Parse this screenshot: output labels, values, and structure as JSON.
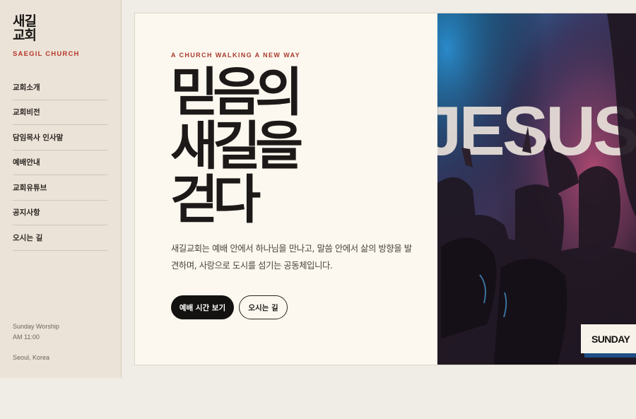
{
  "brand": {
    "name_ko": "새길 교회",
    "name_en": "SAEGIL CHURCH",
    "accent_color": "#b8362b"
  },
  "nav": {
    "items": [
      {
        "label": "교회소개"
      },
      {
        "label": "교회비전"
      },
      {
        "label": "담임목사 인사말"
      },
      {
        "label": "예배안내"
      },
      {
        "label": "교회유튜브"
      },
      {
        "label": "공지사항"
      },
      {
        "label": "오시는 길"
      }
    ]
  },
  "sidebar_info": {
    "worship_name": "Sunday Worship",
    "worship_time": "AM 11:00",
    "location": "Seoul, Korea"
  },
  "hero": {
    "eyebrow": "A CHURCH WALKING A NEW WAY",
    "headline_line1": "믿음의",
    "headline_line2": "새길을",
    "headline_line3": "걷다",
    "description": "새길교회는 예배 안에서 하나님을 만나고, 말씀 안에서 삶의 방향을 발견하며, 사랑으로 도시를 섬기는 공동체입니다.",
    "primary_button": "예배 시간 보기",
    "secondary_button": "오시는 길"
  },
  "photo": {
    "sign_text": "JESUS",
    "badge": "SUNDAY"
  }
}
